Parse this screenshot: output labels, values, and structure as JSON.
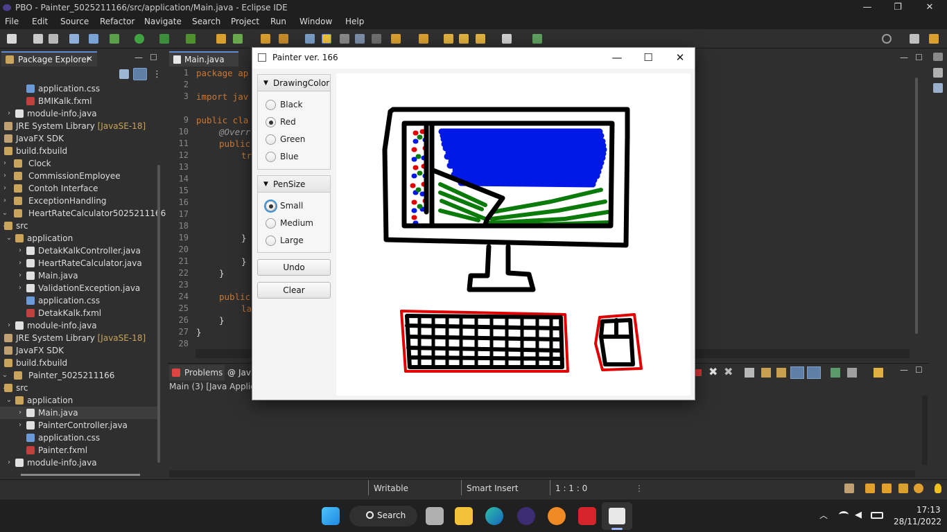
{
  "window_title": "PBO - Painter_5025211166/src/application/Main.java - Eclipse IDE",
  "menu": [
    "File",
    "Edit",
    "Source",
    "Refactor",
    "Navigate",
    "Search",
    "Project",
    "Run",
    "Window",
    "Help"
  ],
  "package_explorer": {
    "tab_label": "Package Explorer",
    "items": [
      {
        "label": "application.css",
        "decor": ""
      },
      {
        "label": "BMIKalk.fxml",
        "decor": ""
      },
      {
        "label": "module-info.java",
        "decor": ""
      },
      {
        "label": "JRE System Library",
        "decor": "[JavaSE-18]"
      },
      {
        "label": "JavaFX SDK",
        "decor": ""
      },
      {
        "label": "build.fxbuild",
        "decor": ""
      },
      {
        "label": "Clock",
        "decor": ""
      },
      {
        "label": "CommissionEmployee",
        "decor": ""
      },
      {
        "label": "Contoh Interface",
        "decor": ""
      },
      {
        "label": "ExceptionHandling",
        "decor": ""
      },
      {
        "label": "HeartRateCalculator5025211166",
        "decor": ""
      },
      {
        "label": "src",
        "decor": ""
      },
      {
        "label": "application",
        "decor": ""
      },
      {
        "label": "DetakKalkController.java",
        "decor": ""
      },
      {
        "label": "HeartRateCalculator.java",
        "decor": ""
      },
      {
        "label": "Main.java",
        "decor": ""
      },
      {
        "label": "ValidationException.java",
        "decor": ""
      },
      {
        "label": "application.css",
        "decor": ""
      },
      {
        "label": "DetakKalk.fxml",
        "decor": ""
      },
      {
        "label": "module-info.java",
        "decor": ""
      },
      {
        "label": "JRE System Library",
        "decor": "[JavaSE-18]"
      },
      {
        "label": "JavaFX SDK",
        "decor": ""
      },
      {
        "label": "build.fxbuild",
        "decor": ""
      },
      {
        "label": "Painter_5025211166",
        "decor": ""
      },
      {
        "label": "src",
        "decor": ""
      },
      {
        "label": "application",
        "decor": ""
      },
      {
        "label": "Main.java",
        "decor": ""
      },
      {
        "label": "PainterController.java",
        "decor": ""
      },
      {
        "label": "application.css",
        "decor": ""
      },
      {
        "label": "Painter.fxml",
        "decor": ""
      },
      {
        "label": "module-info.java",
        "decor": ""
      }
    ]
  },
  "editor": {
    "tab_label": "Main.java",
    "line_numbers": [
      "1",
      "2",
      "3",
      "8",
      "9",
      "10",
      "11",
      "12",
      "13",
      "14",
      "15",
      "16",
      "17",
      "18",
      "19",
      "20",
      "21",
      "22",
      "23",
      "24",
      "25",
      "26",
      "27",
      "28"
    ],
    "code": {
      "l1": "package ap",
      "l3": "import jav",
      "l9": "public cla",
      "l10": "@Overr",
      "l11": "public",
      "l12": "tr",
      "l19": "}",
      "l21": "}",
      "l22": "}",
      "l24": "public",
      "l25": "la",
      "l26": "}",
      "l27": "}"
    }
  },
  "bottom_panel": {
    "problems_tab": "Problems",
    "javadoc_tab": "Jav",
    "console_label": "Main (3) [Java Applicat"
  },
  "status_bar": {
    "writable": "Writable",
    "insert_mode": "Smart Insert",
    "position": "1 : 1 : 0"
  },
  "taskbar": {
    "search_label": "Search",
    "time": "17:13",
    "date": "28/11/2022"
  },
  "painter": {
    "title": "Painter ver. 166",
    "drawing_color": {
      "header": "DrawingColor",
      "options": [
        "Black",
        "Red",
        "Green",
        "Blue"
      ],
      "selected": "Red"
    },
    "pen_size": {
      "header": "PenSize",
      "options": [
        "Small",
        "Medium",
        "Large"
      ],
      "selected": "Small"
    },
    "undo_label": "Undo",
    "clear_label": "Clear"
  },
  "colors": {
    "accent": "#5f8dd3",
    "draw_black": "#000000",
    "draw_red": "#e00000",
    "draw_green": "#0a7a0a",
    "draw_blue": "#0018e8"
  }
}
